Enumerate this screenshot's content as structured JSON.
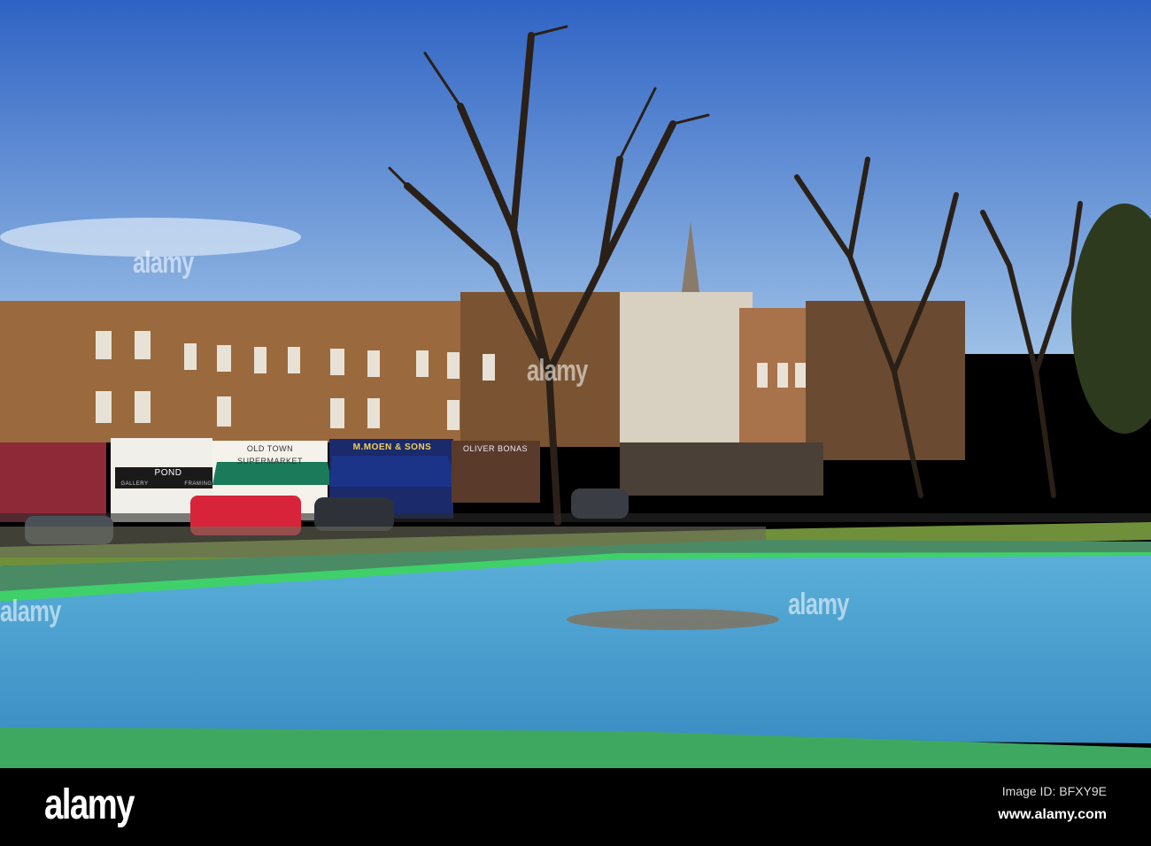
{
  "photo": {
    "signs": {
      "supermarket": "OLD TOWN SUPERMARKET",
      "butcher": "M.MOEN & SONS",
      "oliver": "OLIVER BONAS",
      "pond": "POND",
      "gallery": "GALLERY",
      "framing": "FRAMING"
    },
    "watermark": "alamy"
  },
  "footer": {
    "logo": "alamy",
    "image_id": "Image ID: BFXY9E",
    "website": "www.alamy.com"
  },
  "colors": {
    "sky_top": "#2f63c4",
    "sky_bottom": "#9cc0e6",
    "brick": "#9a6a3e",
    "pool": "#4a9fd0",
    "pool_green": "#3fa860",
    "grass": "#6f8f3a"
  }
}
